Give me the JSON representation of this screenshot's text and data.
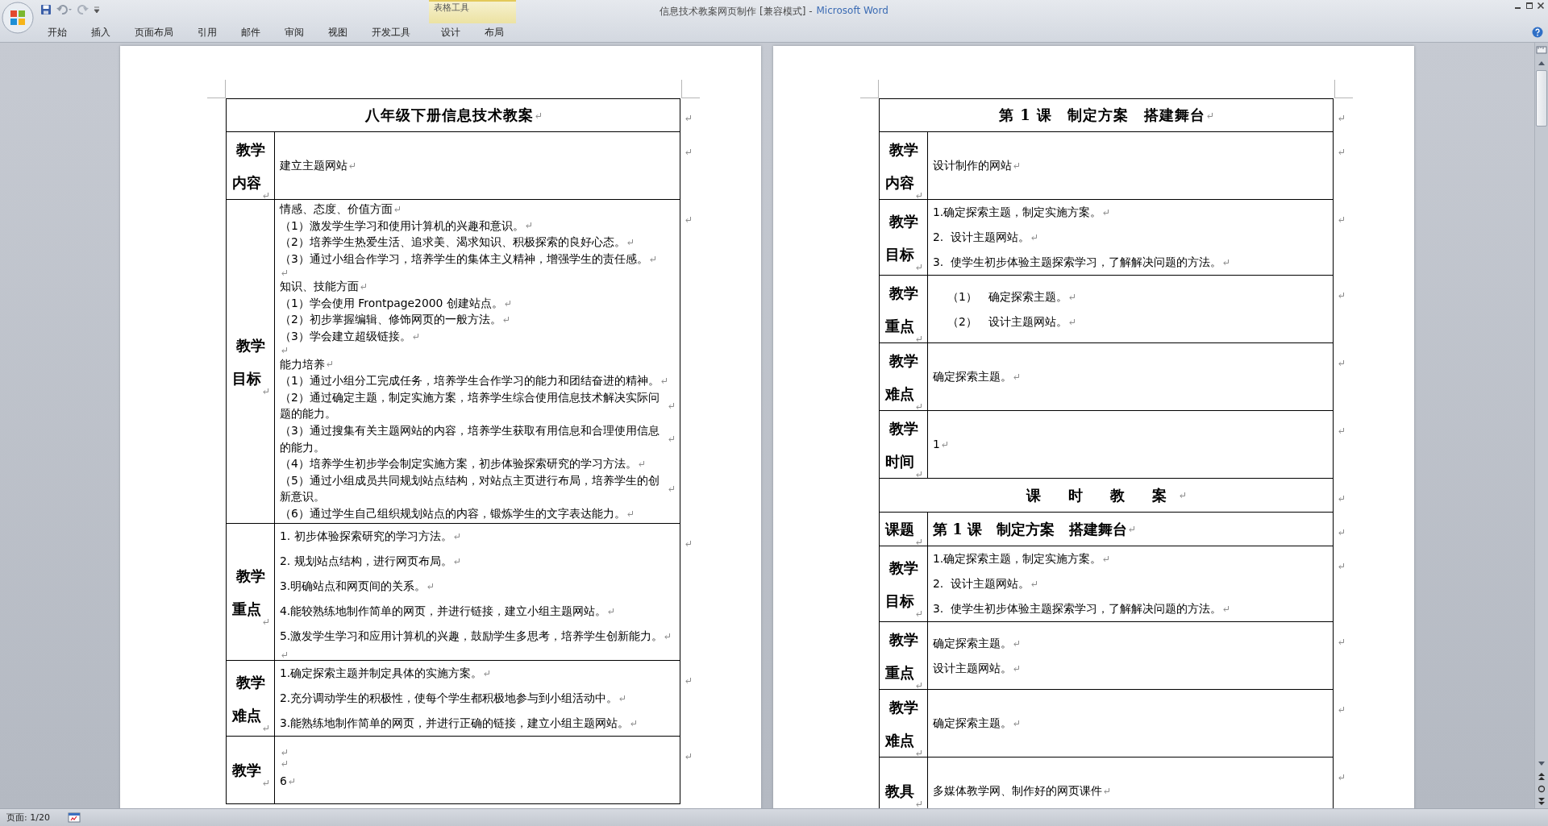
{
  "window": {
    "title": "信息技术教案网页制作 [兼容模式] -",
    "app_name": "Microsoft Word"
  },
  "ribbon_tabs": [
    "开始",
    "插入",
    "页面布局",
    "引用",
    "邮件",
    "审阅",
    "视图",
    "开发工具"
  ],
  "contextual_group": {
    "label": "表格工具",
    "tabs": [
      "设计",
      "布局"
    ]
  },
  "show_formatting_marks": true,
  "pages": [
    {
      "rows": [
        {
          "kind": "title",
          "text": "八年级下册信息技术教案"
        },
        {
          "kind": "field",
          "label": [
            "教学",
            "内容"
          ],
          "paragraphs": [
            {
              "kind": "text",
              "text": "建立主题网站"
            }
          ]
        },
        {
          "kind": "dense_field",
          "label": [
            "教学",
            "目标"
          ],
          "paragraphs": [
            {
              "kind": "text",
              "text": "情感、态度、价值方面"
            },
            {
              "kind": "text",
              "text": "（1）激发学生学习和使用计算机的兴趣和意识。"
            },
            {
              "kind": "text",
              "text": "（2）培养学生热爱生活、追求美、渴求知识、积极探索的良好心态。"
            },
            {
              "kind": "text",
              "text": "（3）通过小组合作学习，培养学生的集体主义精神，增强学生的责任感。"
            },
            {
              "kind": "blank"
            },
            {
              "kind": "text",
              "text": "知识、技能方面"
            },
            {
              "kind": "text",
              "text": "（1）学会使用 Frontpage2000 创建站点。"
            },
            {
              "kind": "text",
              "text": "（2）初步掌握编辑、修饰网页的一般方法。"
            },
            {
              "kind": "text",
              "text": "（3）学会建立超级链接。"
            },
            {
              "kind": "blank"
            },
            {
              "kind": "text",
              "text": "能力培养"
            },
            {
              "kind": "text",
              "text": "（1）通过小组分工完成任务，培养学生合作学习的能力和团结奋进的精神。"
            },
            {
              "kind": "text",
              "text": "（2）通过确定主题，制定实施方案，培养学生综合使用信息技术解决实际问题的能力。"
            },
            {
              "kind": "text",
              "text": "（3）通过搜集有关主题网站的内容，培养学生获取有用信息和合理使用信息的能力。"
            },
            {
              "kind": "text",
              "text": "（4）培养学生初步学会制定实施方案，初步体验探索研究的学习方法。"
            },
            {
              "kind": "text",
              "text": "（5）通过小组成员共同规划站点结构，对站点主页进行布局，培养学生的创新意识。"
            },
            {
              "kind": "text",
              "text": "（6）通过学生自己组织规划站点的内容，锻炼学生的文字表达能力。"
            }
          ]
        },
        {
          "kind": "field",
          "label": [
            "教学",
            "重点"
          ],
          "paragraphs": [
            {
              "kind": "text",
              "text": "1. 初步体验探索研究的学习方法。"
            },
            {
              "kind": "text",
              "text": "2. 规划站点结构，进行网页布局。"
            },
            {
              "kind": "text",
              "text": "3.明确站点和网页间的关系。"
            },
            {
              "kind": "text",
              "text": "4.能较熟练地制作简单的网页，并进行链接，建立小组主题网站。"
            },
            {
              "kind": "text",
              "text": "5.激发学生学习和应用计算机的兴趣，鼓励学生多思考，培养学生创新能力。"
            },
            {
              "kind": "blank"
            }
          ]
        },
        {
          "kind": "field",
          "label": [
            "教学",
            "难点"
          ],
          "paragraphs": [
            {
              "kind": "text",
              "text": "1.确定探索主题并制定具体的实施方案。"
            },
            {
              "kind": "text",
              "text": "2.充分调动学生的积极性，使每个学生都积极地参与到小组活动中。"
            },
            {
              "kind": "text",
              "text": "3.能熟练地制作简单的网页，并进行正确的链接，建立小组主题网站。"
            }
          ]
        },
        {
          "kind": "field",
          "label": [
            "教学"
          ],
          "paragraphs": [
            {
              "kind": "blank"
            },
            {
              "kind": "blank"
            },
            {
              "kind": "text",
              "text": "6"
            }
          ]
        }
      ]
    },
    {
      "rows": [
        {
          "kind": "title",
          "text": "第 1 课　制定方案　搭建舞台"
        },
        {
          "kind": "field",
          "label": [
            "教学",
            "内容"
          ],
          "paragraphs": [
            {
              "kind": "text",
              "text": "设计制作的网站"
            }
          ]
        },
        {
          "kind": "field",
          "label": [
            "教学",
            "目标"
          ],
          "paragraphs": [
            {
              "kind": "text",
              "text": "1.确定探索主题，制定实施方案。"
            },
            {
              "kind": "text",
              "text": "2.  设计主题网站。"
            },
            {
              "kind": "text",
              "text": "3.  使学生初步体验主题探索学习，了解解决问题的方法。"
            }
          ]
        },
        {
          "kind": "field",
          "label": [
            "教学",
            "重点"
          ],
          "paragraphs": [
            {
              "kind": "numbered",
              "number": "（1）",
              "text": "确定探索主题。"
            },
            {
              "kind": "numbered",
              "number": "（2）",
              "text": "设计主题网站。"
            }
          ]
        },
        {
          "kind": "field",
          "label": [
            "教学",
            "难点"
          ],
          "paragraphs": [
            {
              "kind": "text",
              "text": "确定探索主题。"
            }
          ]
        },
        {
          "kind": "field",
          "label": [
            "教学",
            "时间"
          ],
          "paragraphs": [
            {
              "kind": "text",
              "text": "1"
            }
          ]
        },
        {
          "kind": "title",
          "text": "课 时 教 案"
        },
        {
          "kind": "subject",
          "label": [
            "课题"
          ],
          "paragraphs": [
            {
              "kind": "text",
              "text": "第 1 课　制定方案　搭建舞台"
            }
          ]
        },
        {
          "kind": "field",
          "label": [
            "教学",
            "目标"
          ],
          "paragraphs": [
            {
              "kind": "text",
              "text": "1.确定探索主题，制定实施方案。"
            },
            {
              "kind": "text",
              "text": "2.  设计主题网站。"
            },
            {
              "kind": "text",
              "text": "3.  使学生初步体验主题探索学习，了解解决问题的方法。"
            }
          ]
        },
        {
          "kind": "field",
          "label": [
            "教学",
            "重点"
          ],
          "paragraphs": [
            {
              "kind": "text",
              "text": "确定探索主题。"
            },
            {
              "kind": "text",
              "text": "设计主题网站。"
            }
          ]
        },
        {
          "kind": "field",
          "label": [
            "教学",
            "难点"
          ],
          "paragraphs": [
            {
              "kind": "text",
              "text": "确定探索主题。"
            }
          ]
        },
        {
          "kind": "field",
          "label": [
            "教具"
          ],
          "paragraphs": [
            {
              "kind": "text",
              "text": "多媒体教学网、制作好的网页课件"
            }
          ]
        }
      ]
    }
  ],
  "status_bar": {
    "page": "页面: 1/20"
  }
}
